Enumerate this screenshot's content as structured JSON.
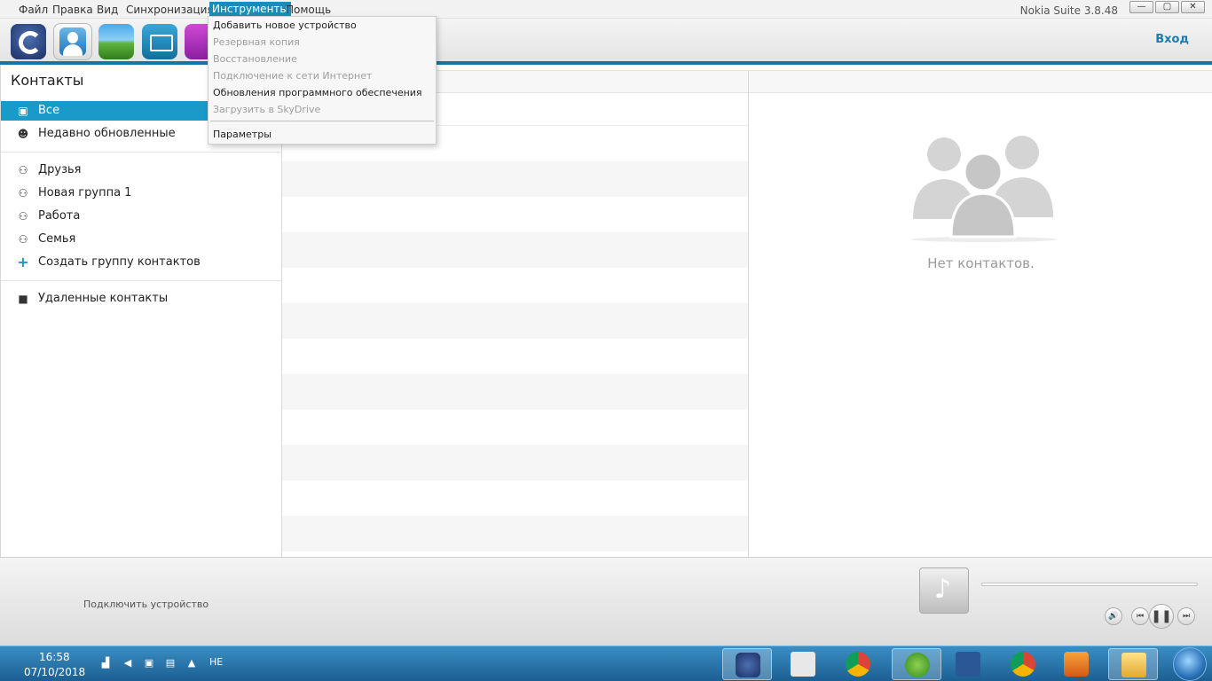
{
  "menubar": {
    "items": [
      "Файл",
      "Правка",
      "Вид",
      "Синхронизация",
      "Инструменты",
      "Помощь"
    ],
    "active_index": 4
  },
  "app_title": "Nokia Suite 3.8.48",
  "window_controls": {
    "minimize": "—",
    "maximize": "▢",
    "close": "✕"
  },
  "toolbar": {
    "apps": [
      "nokia-suite-icon",
      "contacts-icon",
      "photos-icon",
      "mail-icon",
      "music-icon"
    ],
    "login_label": "Вход"
  },
  "tools_menu": {
    "items": [
      {
        "label": "Добавить новое устройство",
        "enabled": true
      },
      {
        "label": "Резервная копия",
        "enabled": false
      },
      {
        "label": "Восстановление",
        "enabled": false
      },
      {
        "label": "Подключение к сети Интернет",
        "enabled": false
      },
      {
        "label": "Обновления программного обеспечения",
        "enabled": true
      },
      {
        "label": "Загрузить в SkyDrive",
        "enabled": false
      },
      {
        "label": "Параметры",
        "enabled": true
      }
    ]
  },
  "contacts_panel": {
    "title": "Контакты",
    "items": [
      {
        "label": "Все",
        "icon": "contact-book-icon",
        "selected": true
      },
      {
        "label": "Недавно обновленные",
        "icon": "recent-contact-icon"
      },
      {
        "label": "Друзья",
        "icon": "group-icon"
      },
      {
        "label": "Новая группа 1",
        "icon": "group-icon"
      },
      {
        "label": "Работа",
        "icon": "group-icon"
      },
      {
        "label": "Семья",
        "icon": "group-icon"
      },
      {
        "label": "Создать группу контактов",
        "icon": "plus-icon"
      },
      {
        "label": "Удаленные контакты",
        "icon": "trash-icon"
      }
    ]
  },
  "detail_panel": {
    "empty_text": "Нет контактов."
  },
  "player": {
    "connect_label": "Подключить устройство",
    "progress": 0
  },
  "taskbar": {
    "time": "16:58",
    "date": "07/10/2018",
    "language": "HE",
    "apps": [
      "nokia-suite-taskbar-icon",
      "dictionary-taskbar-icon",
      "chrome-taskbar-icon",
      "ie-taskbar-icon",
      "word-taskbar-icon",
      "chrome-taskbar-icon",
      "media-player-taskbar-icon",
      "explorer-taskbar-icon"
    ]
  }
}
